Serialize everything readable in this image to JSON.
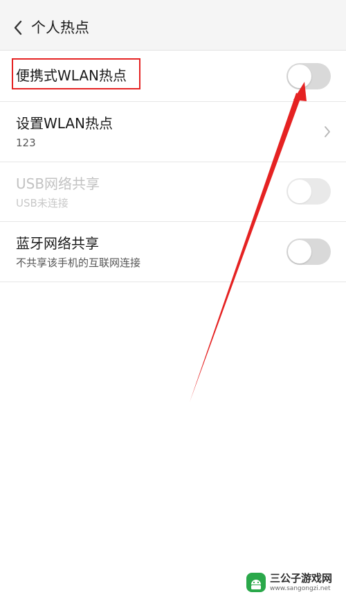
{
  "header": {
    "title": "个人热点",
    "back_icon": "chevron-left-icon"
  },
  "settings": [
    {
      "title": "便携式WLAN热点",
      "toggle": "off",
      "enabled": true
    },
    {
      "title": "设置WLAN热点",
      "subtitle": "123",
      "accessory": "chevron-right-icon"
    },
    {
      "title": "USB网络共享",
      "subtitle": "USB未连接",
      "toggle": "off",
      "enabled": false
    },
    {
      "title": "蓝牙网络共享",
      "subtitle": "不共享该手机的互联网连接",
      "toggle": "off",
      "enabled": true
    }
  ],
  "annotation": {
    "highlight_color": "#e52222",
    "arrow_color": "#e52222"
  },
  "watermark": {
    "name": "三公子游戏网",
    "url": "www.sangongzi.net",
    "color": "#2aa84a"
  }
}
